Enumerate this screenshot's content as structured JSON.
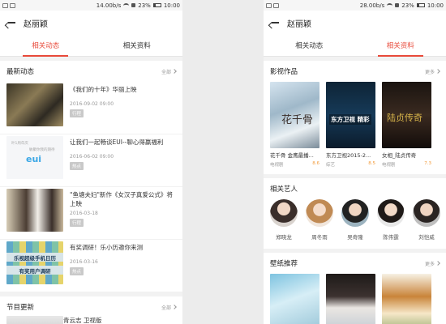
{
  "left": {
    "status": {
      "speed": "14.00b/s",
      "battery": "23%",
      "time": "10:00"
    },
    "nav_title": "赵丽颖",
    "tabs": [
      {
        "label": "相关动态",
        "active": true
      },
      {
        "label": "相关资料",
        "active": false
      }
    ],
    "latest": {
      "title": "最新动态",
      "more": "全部",
      "items": [
        {
          "title": "《我们的十年》华丽上映",
          "date": "2016-09-02 09:00",
          "tag": "行程"
        },
        {
          "title": "让我们一起畅谈EUI--聊心得赢福利",
          "date": "2016-06-02 09:00",
          "tag": "热点",
          "thumb_text_1": "叶1周年庆",
          "thumb_text_2": "敏聚你我的期待",
          "thumb_logo": "eui"
        },
        {
          "title": "\"鱼塘夫妇\"新作《女汉子真爱公式》将上映",
          "date": "2016-03-18",
          "tag": "行程"
        },
        {
          "title": "有奖调研！乐小历邀你来测",
          "date": "2016-03-16",
          "tag": "热点",
          "thumb_band_1": "乐视超级手机日历",
          "thumb_band_2": "有奖用户调研"
        }
      ]
    },
    "programs": {
      "title": "节目更新",
      "more": "全部",
      "first_item": "青云志 卫视版"
    }
  },
  "right": {
    "status": {
      "speed": "28.00b/s",
      "battery": "23%",
      "time": "10:00"
    },
    "nav_title": "赵丽颖",
    "tabs": [
      {
        "label": "相关动态",
        "active": false
      },
      {
        "label": "相关资料",
        "active": true
      }
    ],
    "works": {
      "title": "影视作品",
      "more": "更多",
      "items": [
        {
          "name": "花千骨 金鹰最播...",
          "genre": "电视剧",
          "score": "8.6",
          "poster_text": "花千骨"
        },
        {
          "name": "东方卫视2015-2...",
          "genre": "综艺",
          "score": "8.5",
          "poster_text": "东方卫视 精彩"
        },
        {
          "name": "女相_陆贞传奇",
          "genre": "电视剧",
          "score": "7.3",
          "poster_text": "陆贞传奇"
        }
      ]
    },
    "artists": {
      "title": "相关艺人",
      "items": [
        {
          "name": "郑晓龙"
        },
        {
          "name": "周冬雨"
        },
        {
          "name": "吴奇隆"
        },
        {
          "name": "陈伟霆"
        },
        {
          "name": "刘恺威"
        }
      ]
    },
    "wallpapers": {
      "title": "壁纸推荐",
      "more": "更多"
    }
  },
  "colors": {
    "accent": "#e84a3a",
    "score": "#f29a3a"
  }
}
